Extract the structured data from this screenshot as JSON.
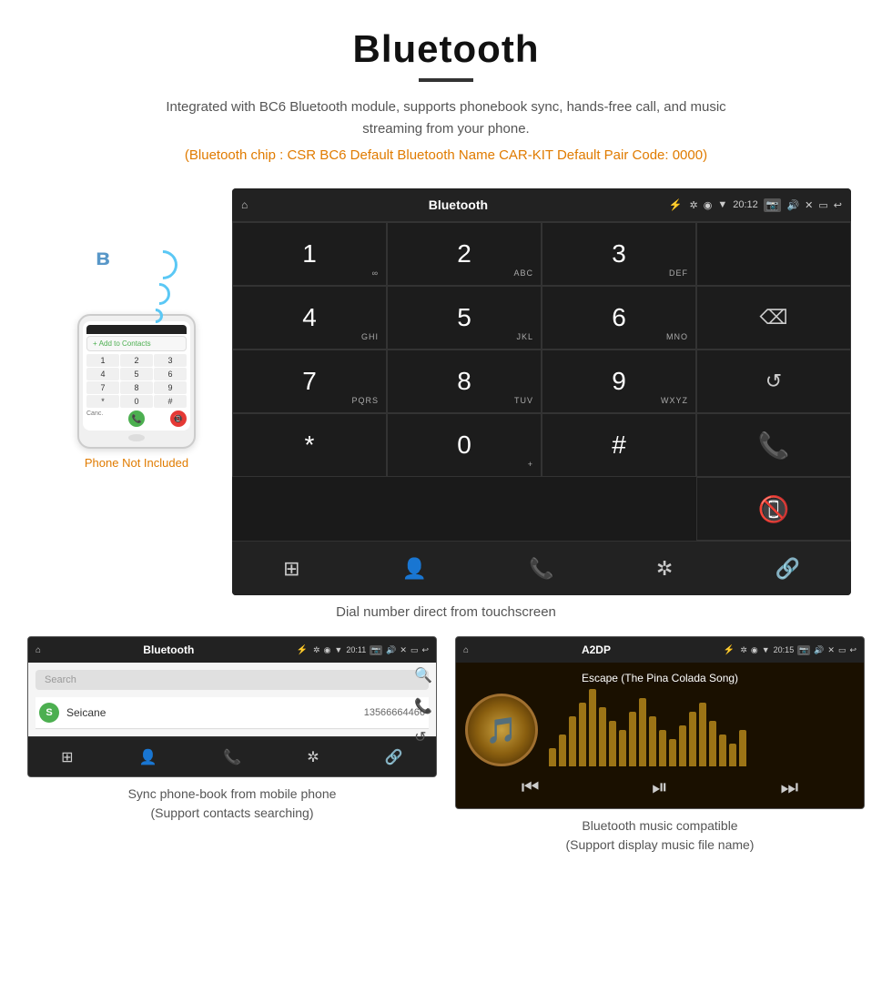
{
  "page": {
    "title": "Bluetooth",
    "subtitle": "Integrated with BC6 Bluetooth module, supports phonebook sync, hands-free call, and music streaming from your phone.",
    "chip_info": "(Bluetooth chip : CSR BC6    Default Bluetooth Name CAR-KIT    Default Pair Code: 0000)"
  },
  "main_screen": {
    "status_bar": {
      "home_icon": "⌂",
      "title": "Bluetooth",
      "usb_icon": "⚡",
      "bt_icon": "✲",
      "location_icon": "◉",
      "signal_icon": "▼",
      "time": "20:12",
      "camera_icon": "📷",
      "volume_icon": "🔊",
      "close_icon": "✕",
      "window_icon": "▭",
      "back_icon": "↩"
    },
    "dialpad": {
      "keys": [
        {
          "label": "1",
          "sub": "∞"
        },
        {
          "label": "2",
          "sub": "ABC"
        },
        {
          "label": "3",
          "sub": "DEF"
        },
        {
          "label": "",
          "sub": "",
          "type": "empty"
        },
        {
          "label": "4",
          "sub": "GHI"
        },
        {
          "label": "5",
          "sub": "JKL"
        },
        {
          "label": "6",
          "sub": "MNO"
        },
        {
          "label": "⌫",
          "sub": "",
          "type": "delete"
        },
        {
          "label": "7",
          "sub": "PQRS"
        },
        {
          "label": "8",
          "sub": "TUV"
        },
        {
          "label": "9",
          "sub": "WXYZ"
        },
        {
          "label": "↺",
          "sub": "",
          "type": "reload"
        },
        {
          "label": "*",
          "sub": ""
        },
        {
          "label": "0",
          "sub": "+"
        },
        {
          "label": "#",
          "sub": ""
        },
        {
          "label": "📞",
          "sub": "",
          "type": "call"
        },
        {
          "label": "📵",
          "sub": "",
          "type": "end"
        }
      ],
      "bottom_icons": [
        "⊞",
        "👤",
        "📞",
        "✲",
        "🔗"
      ]
    }
  },
  "dial_caption": "Dial number direct from touchscreen",
  "contacts_screen": {
    "status_bar": {
      "home_icon": "⌂",
      "title": "Bluetooth",
      "time": "20:11"
    },
    "search_placeholder": "Search",
    "contacts": [
      {
        "letter": "S",
        "name": "Seicane",
        "number": "13566664466"
      }
    ],
    "bottom_icons": [
      "⊞",
      "👤",
      "📞",
      "✲",
      "🔗"
    ],
    "side_icons": [
      "🔍",
      "📞",
      "↺"
    ]
  },
  "contacts_caption": "Sync phone-book from mobile phone\n(Support contacts searching)",
  "music_screen": {
    "status_bar": {
      "home_icon": "⌂",
      "title": "A2DP",
      "time": "20:15"
    },
    "song_title": "Escape (The Pina Colada Song)",
    "controls": [
      "⏮",
      "⏯",
      "⏭"
    ],
    "eq_bars": [
      20,
      35,
      55,
      70,
      85,
      65,
      50,
      40,
      60,
      75,
      55,
      40,
      30,
      45,
      60,
      70,
      50,
      35,
      25,
      40
    ]
  },
  "music_caption": "Bluetooth music compatible\n(Support display music file name)",
  "phone_not_included": "Phone Not Included",
  "phone_keypad": [
    "1",
    "2",
    "3",
    "4",
    "5",
    "6",
    "7",
    "8",
    "9",
    "*",
    "0",
    "#"
  ]
}
